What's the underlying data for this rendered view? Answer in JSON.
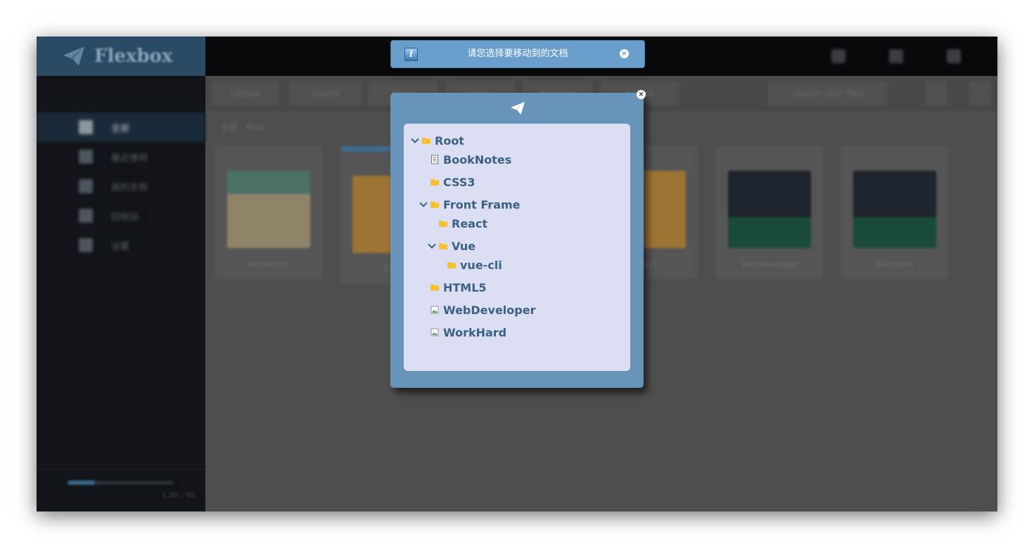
{
  "app": {
    "logo_text": "Flexbox",
    "breadcrumb": "全部 · Root"
  },
  "sidebar": {
    "items": [
      {
        "label": "全部"
      },
      {
        "label": "最近使用"
      },
      {
        "label": "我的文档"
      },
      {
        "label": "回收站"
      },
      {
        "label": "设置"
      }
    ],
    "storage_percent": 26,
    "storage_text": "1.3G / 5G"
  },
  "toolbar": {
    "buttons": [
      "Upload",
      "Create",
      "Move",
      "Copy",
      "Rename",
      "Delete"
    ],
    "search_placeholder": "Search your files"
  },
  "files": [
    {
      "name": "BookNotes",
      "kind": "doc"
    },
    {
      "name": "CSS3",
      "kind": "folder"
    },
    {
      "name": "Front Frame",
      "kind": "folder"
    },
    {
      "name": "HTML5",
      "kind": "folder"
    },
    {
      "name": "WebDeveloper",
      "kind": "image"
    },
    {
      "name": "WorkHard",
      "kind": "image"
    }
  ],
  "notice": {
    "message": "请您选择要移动到的文档",
    "icon": "info-icon"
  },
  "move_dialog": {
    "icon": "paper-plane-icon",
    "tree": {
      "root": "Root",
      "booknotes": "BookNotes",
      "css3": "CSS3",
      "front_frame": "Front Frame",
      "react": "React",
      "vue": "Vue",
      "vue_cli": "vue-cli",
      "html5": "HTML5",
      "webdeveloper": "WebDeveloper",
      "workhard": "WorkHard"
    }
  },
  "colors": {
    "dialog_bg": "#6994ba",
    "tree_bg": "#dcdef3",
    "tree_text": "#3a6182",
    "notice_bg": "#6a9fcd",
    "folder": "#f5c133"
  }
}
